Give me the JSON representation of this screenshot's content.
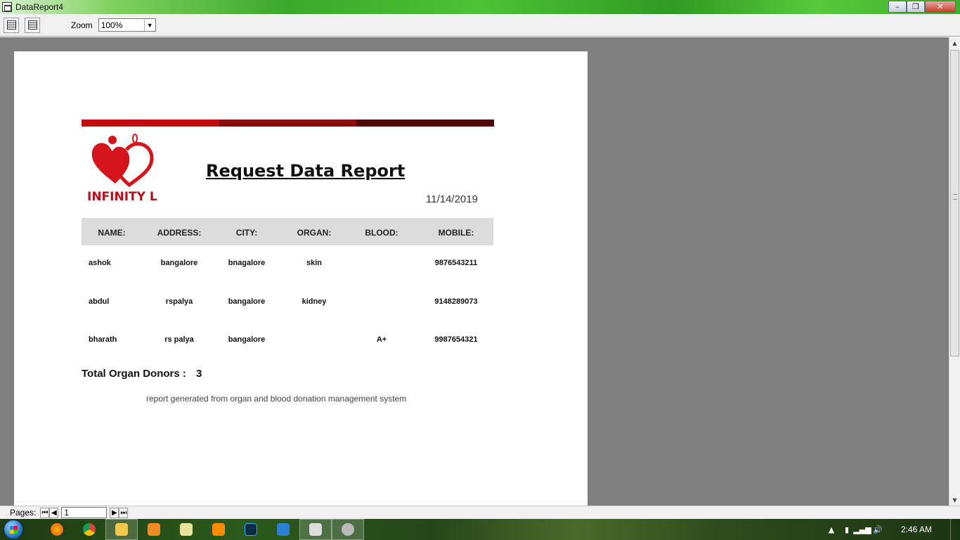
{
  "window": {
    "title": "DataReport4",
    "min": "–",
    "max": "❐",
    "close": "✕"
  },
  "toolbar": {
    "zoom_label": "Zoom",
    "zoom_value": "100%"
  },
  "report": {
    "title": "Request Data Report",
    "date": "11/14/2019",
    "logo_text": "INFINITY LIFE",
    "bar_colors": [
      "#c00d0d",
      "#8e0b0b",
      "#4f0606"
    ],
    "columns": [
      "NAME:",
      "ADDRESS:",
      "CITY:",
      "ORGAN:",
      "BLOOD:",
      "MOBILE:"
    ],
    "rows": [
      {
        "name": "ashok",
        "address": "bangalore",
        "city": "bnagalore",
        "organ": "skin",
        "blood": "",
        "mobile": "9876543211"
      },
      {
        "name": "abdul",
        "address": "rspalya",
        "city": "bangalore",
        "organ": "kidney",
        "blood": "",
        "mobile": "9148289073"
      },
      {
        "name": "bharath",
        "address": "rs palya",
        "city": "bangalore",
        "organ": "",
        "blood": "A+",
        "mobile": "9987654321"
      }
    ],
    "total_label": "Total Organ Donors :",
    "total_value": "3",
    "footer": "report generated from organ and blood donation management system"
  },
  "pager": {
    "label": "Pages:",
    "page": "1"
  },
  "taskbar": {
    "apps": [
      "firefox-icon",
      "chrome-icon",
      "explorer-icon",
      "media-player-icon",
      "notepad-icon",
      "sublime-icon",
      "photoshop-icon",
      "app-icon",
      "datareport-icon",
      "vb-icon"
    ],
    "clock": "2:46 AM"
  }
}
